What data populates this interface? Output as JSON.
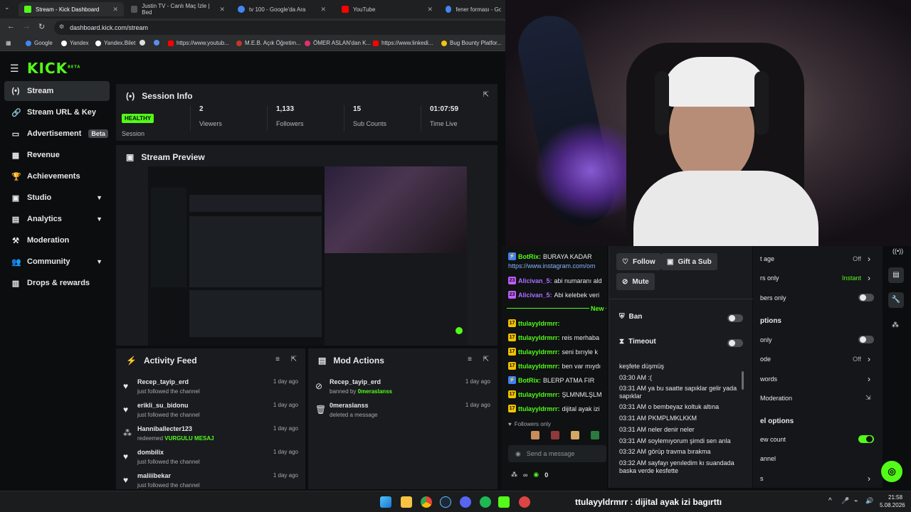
{
  "browser": {
    "tabs": [
      {
        "label": "Stream - Kick Dashboard",
        "color": "#53fc18"
      },
      {
        "label": "Justin TV - Canlı Maç İzle | Bed",
        "color": "#333"
      },
      {
        "label": "tv 100 - Google'da Ara",
        "color": "#4285f4"
      },
      {
        "label": "YouTube",
        "color": "#ff0000"
      },
      {
        "label": "fener forması - Googl",
        "color": "#4285f4"
      }
    ],
    "url": "dashboard.kick.com/stream",
    "bookmarks": [
      "Google",
      "Yandex",
      "Yandex.Bilet",
      "https://www.youtub...",
      "M.E.B. Açık Öğretim...",
      "ÖMER ASLAN'dan K...",
      "https://www.linkedi...",
      "Bug Bounty Platfor..."
    ]
  },
  "sidebar": {
    "logo": "KICK",
    "logo_sup": "BETA",
    "items": [
      {
        "label": "Stream",
        "icon": "(•)"
      },
      {
        "label": "Stream URL & Key",
        "icon": "🔗"
      },
      {
        "label": "Advertisement",
        "icon": "▭",
        "badge": "Beta"
      },
      {
        "label": "Revenue",
        "icon": "▦"
      },
      {
        "label": "Achievements",
        "icon": "🏆"
      },
      {
        "label": "Studio",
        "icon": "▣"
      },
      {
        "label": "Analytics",
        "icon": "▤"
      },
      {
        "label": "Moderation",
        "icon": "⚒"
      },
      {
        "label": "Community",
        "icon": "👥"
      },
      {
        "label": "Drops & rewards",
        "icon": "▥"
      }
    ]
  },
  "session": {
    "title": "Session Info",
    "status": "HEALTHY",
    "status_label": "Session",
    "stats": [
      {
        "value": "2",
        "label": "Viewers"
      },
      {
        "value": "1,133",
        "label": "Followers"
      },
      {
        "value": "15",
        "label": "Sub Counts"
      },
      {
        "value": "01:07:59",
        "label": "Time Live"
      }
    ]
  },
  "preview": {
    "title": "Stream Preview"
  },
  "activity": {
    "title": "Activity Feed",
    "items": [
      {
        "name": "Recep_tayip_erd",
        "desc": "just followed the channel",
        "time": "1 day ago",
        "icon": "♥"
      },
      {
        "name": "erikli_su_bidonu",
        "desc": "just followed the channel",
        "time": "1 day ago",
        "icon": "♥"
      },
      {
        "name": "Hanniballecter123",
        "desc": "redeemed",
        "highlight": "VURGULU MESAJ",
        "time": "1 day ago",
        "icon": "⁂"
      },
      {
        "name": "dombilix",
        "desc": "just followed the channel",
        "time": "1 day ago",
        "icon": "♥"
      },
      {
        "name": "maliiibekar",
        "desc": "just followed the channel",
        "time": "1 day ago",
        "icon": "♥"
      }
    ]
  },
  "modactions": {
    "title": "Mod Actions",
    "items": [
      {
        "name": "Recep_tayip_erd",
        "desc": "banned by",
        "highlight": "0meraslanss",
        "time": "1 day ago",
        "icon": "⊘"
      },
      {
        "name": "0meraslanss",
        "desc": "deleted a message",
        "time": "1 day ago",
        "icon": "🗑"
      }
    ]
  },
  "chat": {
    "lines": [
      {
        "user": "BotRix:",
        "text": "BURAYA KADAR",
        "color": "#53fc18",
        "badge": ""
      },
      {
        "user": "",
        "text": "https://www.instagram.com/om",
        "color": "#8ab4f8",
        "badge": ""
      },
      {
        "user": "Alicivan_5:",
        "text": "abi numaranı ald",
        "color": "#a970ff",
        "badge": "23"
      },
      {
        "user": "Alicivan_5:",
        "text": "Abi kelebek veri",
        "color": "#a970ff",
        "badge": "23"
      },
      {
        "user": "ttulayyldrmrr:",
        "text": "",
        "color": "#53fc18",
        "badge": "17"
      },
      {
        "user": "ttulayyldrmrr:",
        "text": "reis merhaba",
        "color": "#53fc18",
        "badge": "17"
      },
      {
        "user": "ttulayyldrmrr:",
        "text": "seni bırıyle k",
        "color": "#53fc18",
        "badge": "17"
      },
      {
        "user": "ttulayyldrmrr:",
        "text": "ben var mıydı",
        "color": "#53fc18",
        "badge": "17"
      },
      {
        "user": "BotRix:",
        "text": "BLERP ATMA FIR",
        "color": "#53fc18",
        "badge": ""
      },
      {
        "user": "ttulayyldrmrr:",
        "text": "ŞLMNMLŞLM",
        "color": "#53fc18",
        "badge": "17"
      },
      {
        "user": "ttulayyldrmrr:",
        "text": "dijital ayak izi",
        "color": "#53fc18",
        "badge": "17"
      }
    ],
    "new_label": "New",
    "followers_only": "Followers only",
    "send_placeholder": "Send a message",
    "count": "0"
  },
  "popover": {
    "follow": "Follow",
    "gift": "Gift a Sub",
    "mute": "Mute",
    "ban": "Ban",
    "timeout": "Timeout",
    "messages": [
      "keşfete düşmüş",
      "03:30 AM :(",
      "03:31 AM ya bu saatte sapıklar gelir yada sapıklar",
      "03:31 AM o bembeyaz koltuk altına",
      "03:31 AM PKMPLMKLKKM",
      "03:31 AM neler denir neler",
      "03:31 AM soylemıyorum şimdi sen anla",
      "03:32 AM görüp travma bırakma",
      "03:32 AM sayfayı yenıledim kı suandada baska verde kesfette"
    ]
  },
  "settings": {
    "rows": [
      {
        "label": "t age",
        "value": "Off"
      },
      {
        "label": "rs only",
        "value": "Instant"
      },
      {
        "label": "bers only",
        "value": ""
      },
      {
        "label": "ptions",
        "value": ""
      },
      {
        "label": "only",
        "value": ""
      },
      {
        "label": "ode",
        "value": "Off"
      },
      {
        "label": "words",
        "value": ""
      },
      {
        "label": "Moderation",
        "value": ""
      },
      {
        "label": "el options",
        "value": ""
      },
      {
        "label": "ew count",
        "value": ""
      },
      {
        "label": "annel",
        "value": ""
      },
      {
        "label": "s",
        "value": ""
      }
    ]
  },
  "overlay_caption": "ttulayyldrmrr : dijital ayak izi bagırttı",
  "clock": {
    "time": "21:58",
    "date": "5.08.2026"
  }
}
